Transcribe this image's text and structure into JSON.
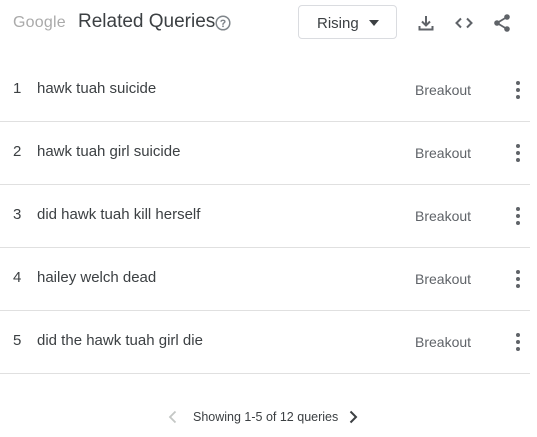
{
  "header": {
    "brand": "Google",
    "title": "Related Queries",
    "filter": {
      "selected": "Rising"
    },
    "icons": [
      "help-icon",
      "download-icon",
      "embed-code-icon",
      "share-icon"
    ]
  },
  "rows": [
    {
      "index": "1",
      "query": "hawk tuah suicide",
      "value": "Breakout"
    },
    {
      "index": "2",
      "query": "hawk tuah girl suicide",
      "value": "Breakout"
    },
    {
      "index": "3",
      "query": "did hawk tuah kill herself",
      "value": "Breakout"
    },
    {
      "index": "4",
      "query": "hailey welch dead",
      "value": "Breakout"
    },
    {
      "index": "5",
      "query": "did the hawk tuah girl die",
      "value": "Breakout"
    }
  ],
  "pagination": {
    "text": "Showing 1-5 of 12 queries"
  },
  "colors": {
    "text": "#3c4043",
    "muted": "#5f6368",
    "divider": "#e0e0e0",
    "brand": "#aaaaaa"
  }
}
